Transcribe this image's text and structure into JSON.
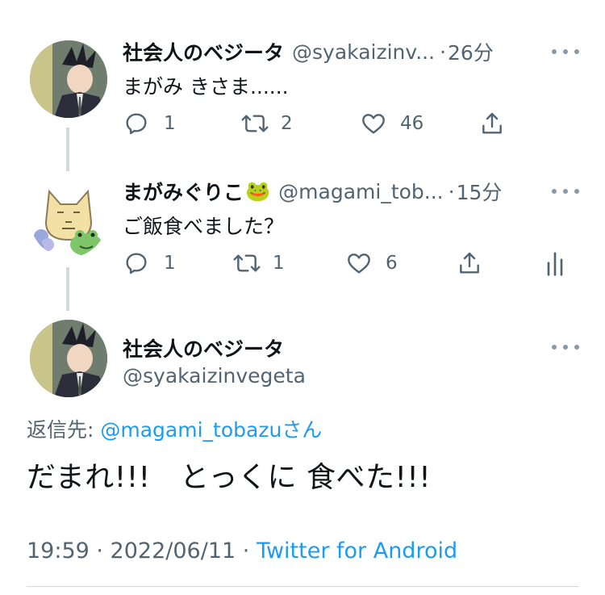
{
  "tweets": [
    {
      "name": "社会人のベジータ",
      "handle": "@syakaizinv...",
      "separator": "·",
      "time": "26分",
      "text": "まがみ  きさま......",
      "reply_count": "1",
      "retweet_count": "2",
      "like_count": "46"
    },
    {
      "name": "まがみぐりこ",
      "name_emoji": "🐸",
      "handle": "@magami_tob...",
      "separator": "·",
      "time": "15分",
      "text": "ご飯食べました？",
      "reply_count": "1",
      "retweet_count": "1",
      "like_count": "6"
    }
  ],
  "main_tweet": {
    "name": "社会人のベジータ",
    "handle": "@syakaizinvegeta",
    "reply_label": "返信先: ",
    "reply_mention": "@magami_tobazuさん",
    "text": "だまれ!!!　とっくに 食べた!!!",
    "timestamp": "19:59 · 2022/06/11 · ",
    "client": "Twitter for Android"
  },
  "icons": {
    "reply": "reply-icon",
    "retweet": "retweet-icon",
    "like": "heart-icon",
    "share": "share-icon",
    "analytics": "analytics-icon",
    "more": "more-icon"
  },
  "colors": {
    "text": "#0f1419",
    "secondary": "#536471",
    "link": "#1d9bf0",
    "thread_line": "#cfd9de"
  }
}
